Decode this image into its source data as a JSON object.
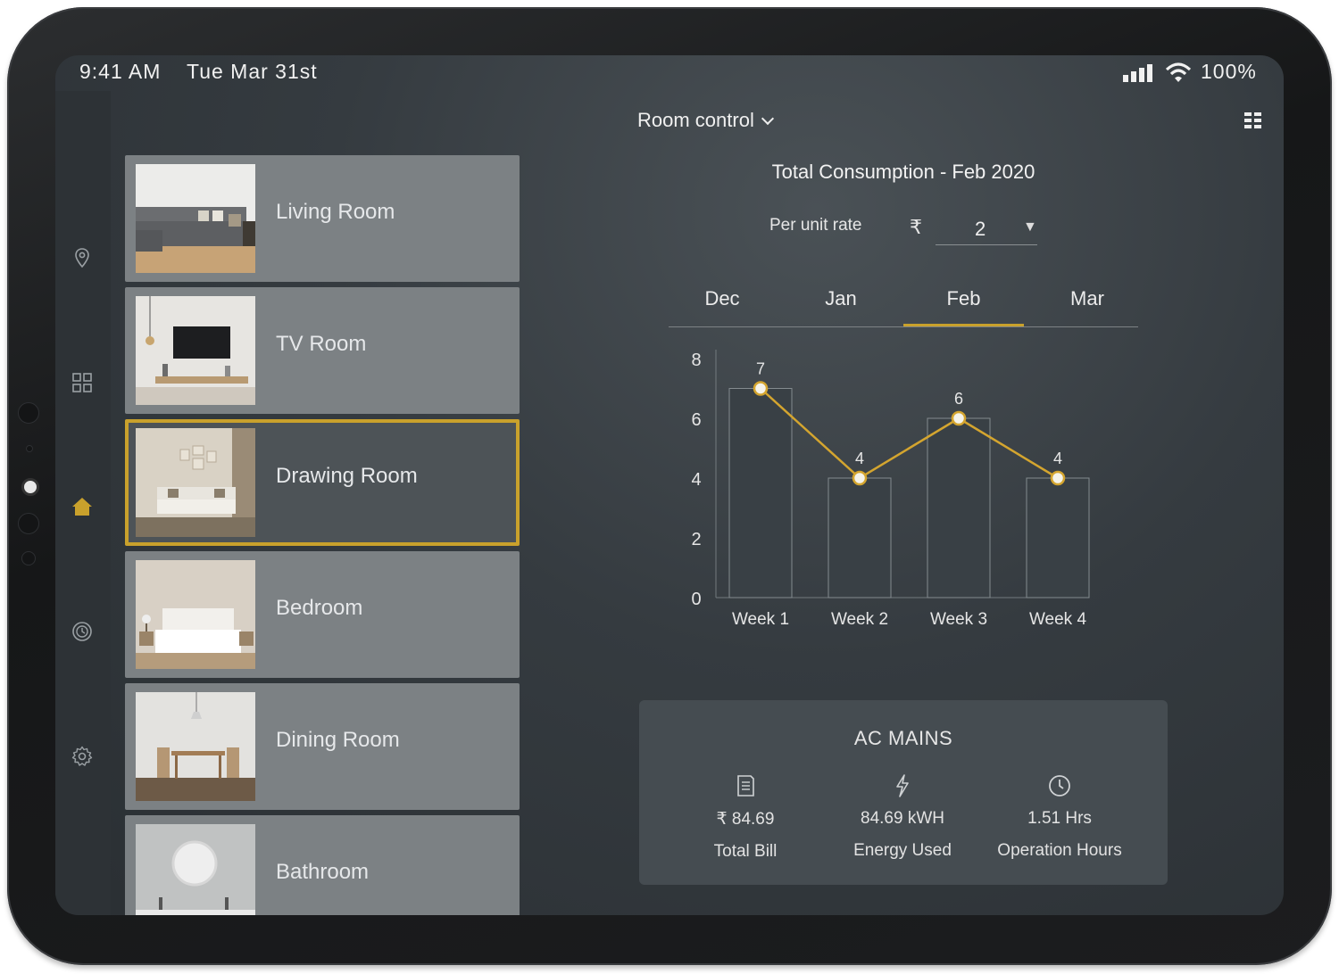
{
  "status_bar": {
    "time": "9:41 AM",
    "date": "Tue Mar 31st",
    "battery": "100%"
  },
  "sidebar": {
    "items": [
      "location-icon",
      "dashboard-icon",
      "home-icon",
      "history-icon",
      "settings-icon"
    ],
    "active": "home-icon"
  },
  "header": {
    "title": "Room control"
  },
  "rooms": [
    {
      "name": "Living Room",
      "selected": false
    },
    {
      "name": "TV Room",
      "selected": false
    },
    {
      "name": "Drawing Room",
      "selected": true
    },
    {
      "name": "Bedroom",
      "selected": false
    },
    {
      "name": "Dining Room",
      "selected": false
    },
    {
      "name": "Bathroom",
      "selected": false
    }
  ],
  "consumption": {
    "title": "Total Consumption - Feb 2020",
    "rate_label": "Per unit rate",
    "currency_symbol": "₹",
    "rate_value": "2"
  },
  "months": [
    "Dec",
    "Jan",
    "Feb",
    "Mar"
  ],
  "active_month": "Feb",
  "chart_data": {
    "type": "bar",
    "categories": [
      "Week 1",
      "Week 2",
      "Week 3",
      "Week 4"
    ],
    "series": [
      {
        "type": "bar",
        "values": [
          7,
          4,
          6,
          4
        ]
      },
      {
        "type": "line",
        "values": [
          7,
          4,
          6,
          4
        ]
      }
    ],
    "data_labels": [
      "7",
      "4",
      "6",
      "4"
    ],
    "yticks": [
      0,
      2,
      4,
      6,
      8
    ],
    "ylim": [
      0,
      8
    ],
    "line_color": "#d4a52f",
    "title": "",
    "xlabel": "",
    "ylabel": ""
  },
  "ac_mains": {
    "title": "AC MAINS",
    "stats": [
      {
        "icon": "bill-icon",
        "value": "₹ 84.69",
        "label": "Total Bill"
      },
      {
        "icon": "lightning-icon",
        "value": "84.69 kWH",
        "label": "Energy Used"
      },
      {
        "icon": "clock-icon",
        "value": "1.51 Hrs",
        "label": "Operation Hours"
      }
    ]
  },
  "colors": {
    "accent": "#c9a12c",
    "screen_bg": "#353b40",
    "card_bg": "#454c51",
    "room_card": "#7c8184"
  }
}
